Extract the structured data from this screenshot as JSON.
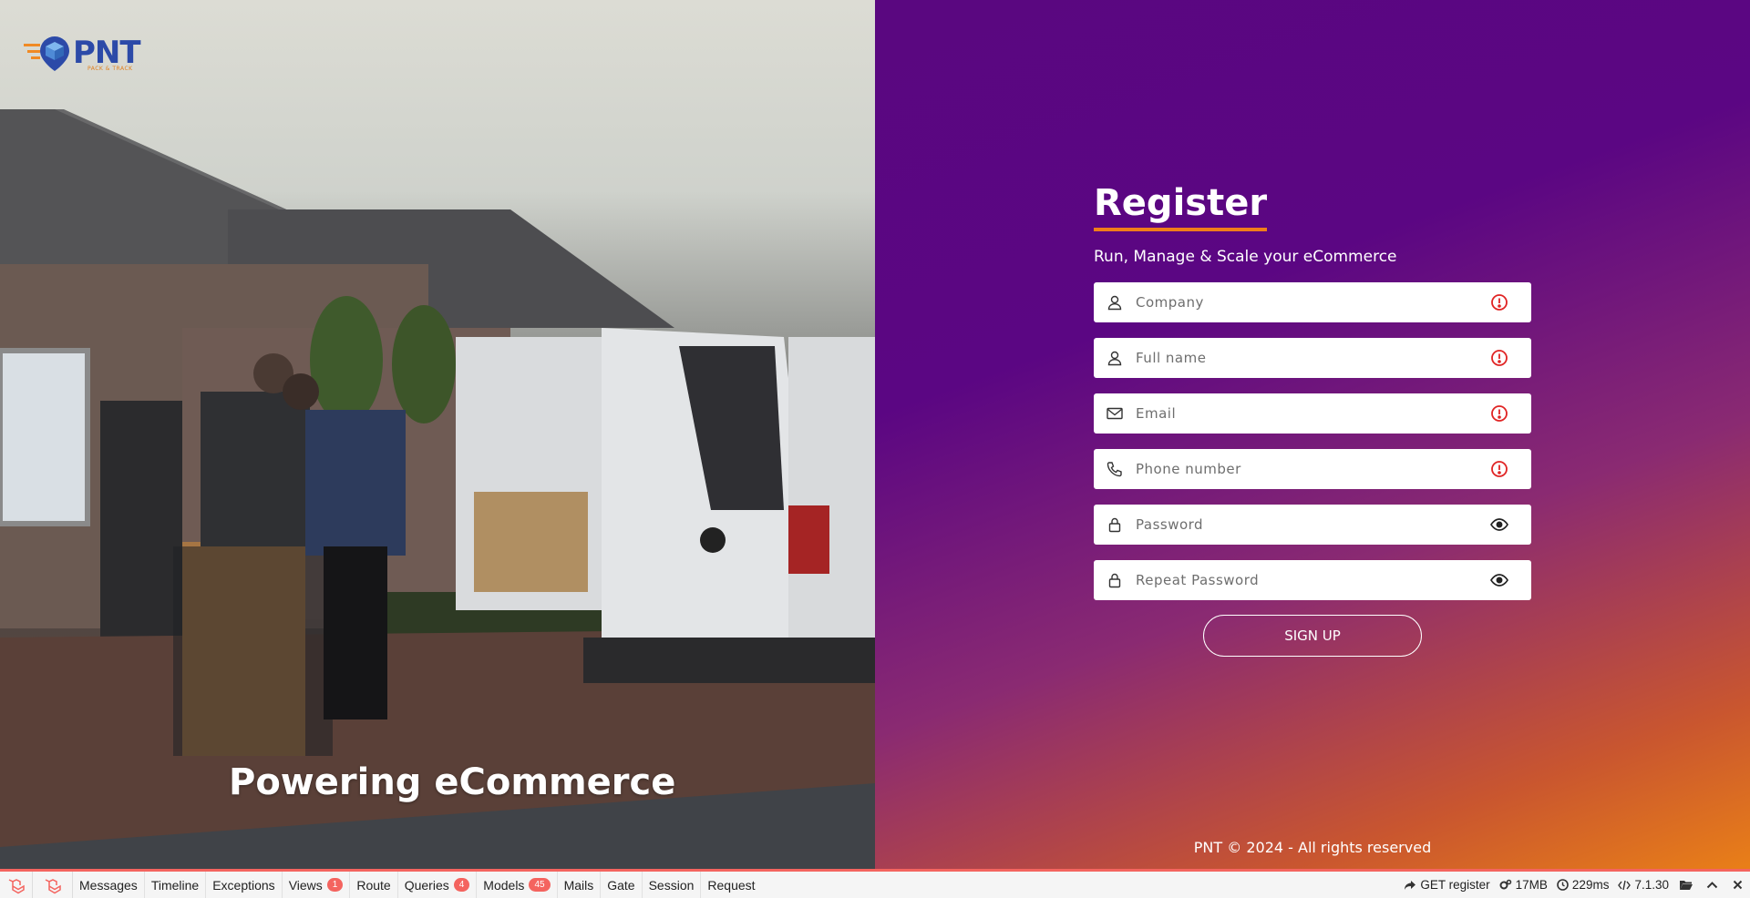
{
  "brand": {
    "logo_text": "PNT",
    "logo_sub": "PACK & TRACK"
  },
  "hero": {
    "tagline": "Powering eCommerce"
  },
  "register": {
    "title": "Register",
    "subtitle": "Run, Manage & Scale your eCommerce",
    "fields": [
      {
        "name": "company",
        "placeholder": "Company",
        "value": "",
        "icon": "user-icon",
        "trailing": "error-icon"
      },
      {
        "name": "full-name",
        "placeholder": "Full name",
        "value": "",
        "icon": "user-icon",
        "trailing": "error-icon"
      },
      {
        "name": "email",
        "placeholder": "Email",
        "value": "",
        "icon": "mail-icon",
        "trailing": "error-icon"
      },
      {
        "name": "phone",
        "placeholder": "Phone number",
        "value": "",
        "icon": "phone-icon",
        "trailing": "error-icon"
      },
      {
        "name": "password",
        "placeholder": "Password",
        "value": "",
        "icon": "lock-icon",
        "trailing": "eye-icon"
      },
      {
        "name": "repeat-password",
        "placeholder": "Repeat Password",
        "value": "",
        "icon": "lock-icon",
        "trailing": "eye-icon"
      }
    ],
    "submit_label": "SIGN UP",
    "footer": "PNT © 2024 - All rights reserved"
  },
  "debugbar": {
    "tabs": [
      {
        "label": "Messages",
        "badge": ""
      },
      {
        "label": "Timeline",
        "badge": ""
      },
      {
        "label": "Exceptions",
        "badge": ""
      },
      {
        "label": "Views",
        "badge": "1"
      },
      {
        "label": "Route",
        "badge": ""
      },
      {
        "label": "Queries",
        "badge": "4"
      },
      {
        "label": "Models",
        "badge": "45"
      },
      {
        "label": "Mails",
        "badge": ""
      },
      {
        "label": "Gate",
        "badge": ""
      },
      {
        "label": "Session",
        "badge": ""
      },
      {
        "label": "Request",
        "badge": ""
      }
    ],
    "route": "GET register",
    "memory": "17MB",
    "time": "229ms",
    "version": "7.1.30"
  },
  "colors": {
    "panel_purple": "#5a0780",
    "panel_orange": "#e97f18",
    "accent": "#f07e1a",
    "error": "#e02424",
    "debug_badge": "#f4645f"
  }
}
